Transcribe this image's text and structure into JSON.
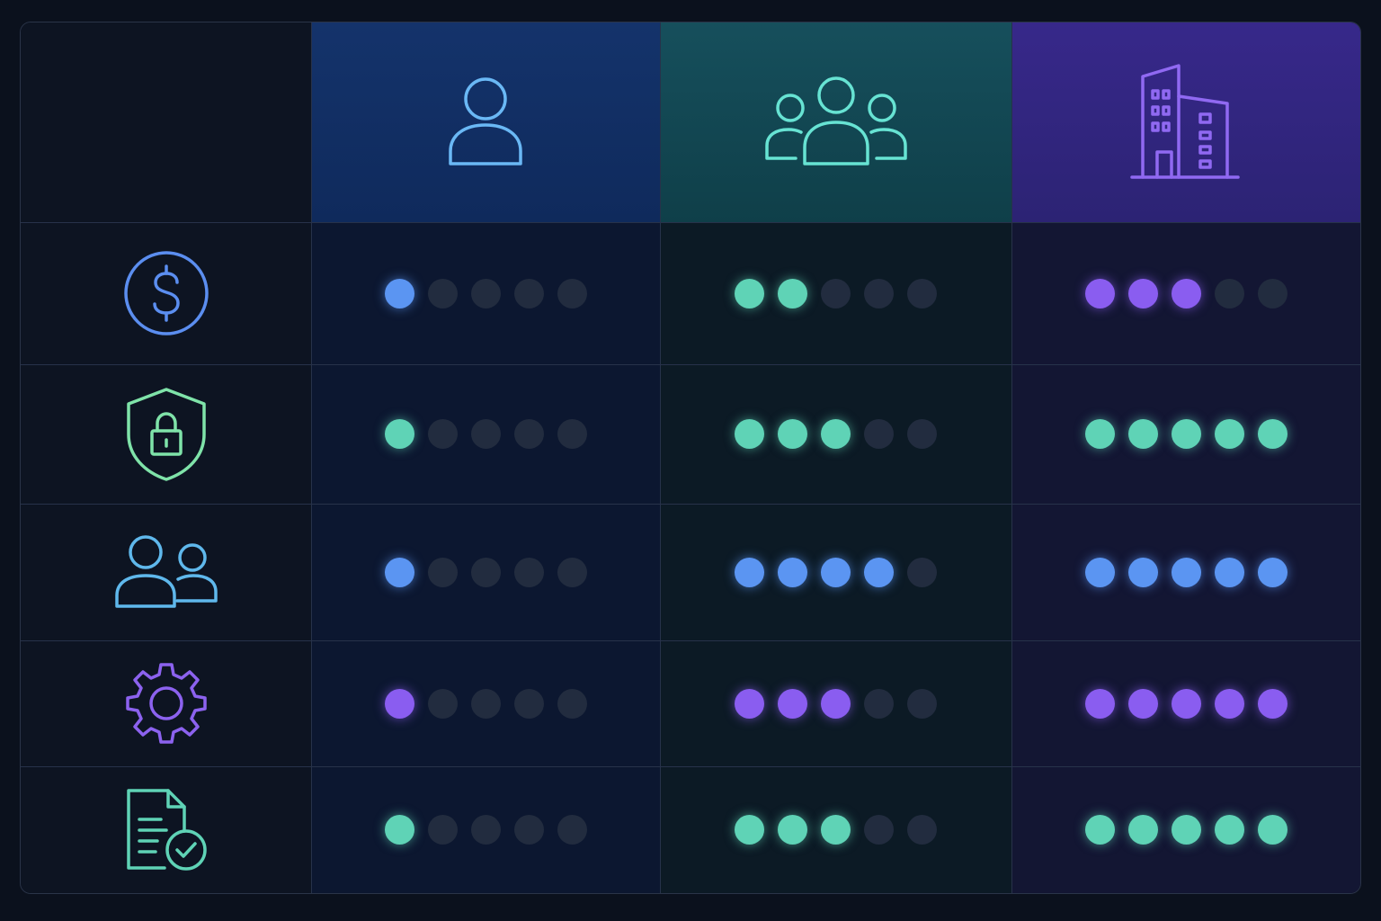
{
  "columns": [
    {
      "icon": "person-icon"
    },
    {
      "icon": "group-icon"
    },
    {
      "icon": "building-icon"
    }
  ],
  "rows": [
    {
      "icon": "dollar-circle-icon",
      "color": "#5b95f2",
      "ratings": [
        {
          "level": 1,
          "color": "blue"
        },
        {
          "level": 2,
          "color": "teal"
        },
        {
          "level": 3,
          "color": "purple"
        }
      ]
    },
    {
      "icon": "shield-lock-icon",
      "color": "#5fd3b6",
      "ratings": [
        {
          "level": 1,
          "color": "teal"
        },
        {
          "level": 3,
          "color": "teal"
        },
        {
          "level": 5,
          "color": "teal"
        }
      ]
    },
    {
      "icon": "users-icon",
      "color": "#5b95f2",
      "ratings": [
        {
          "level": 1,
          "color": "blue"
        },
        {
          "level": 4,
          "color": "blue"
        },
        {
          "level": 5,
          "color": "blue"
        }
      ]
    },
    {
      "icon": "gear-icon",
      "color": "#8a5df0",
      "ratings": [
        {
          "level": 1,
          "color": "purple"
        },
        {
          "level": 3,
          "color": "purple"
        },
        {
          "level": 5,
          "color": "purple"
        }
      ]
    },
    {
      "icon": "document-check-icon",
      "color": "#5fd3b6",
      "ratings": [
        {
          "level": 1,
          "color": "teal"
        },
        {
          "level": 3,
          "color": "teal"
        },
        {
          "level": 5,
          "color": "teal"
        }
      ]
    }
  ],
  "max_rating": 5,
  "colors": {
    "blue": "#5b95f2",
    "teal": "#5fd3b6",
    "purple": "#8a5df0"
  }
}
